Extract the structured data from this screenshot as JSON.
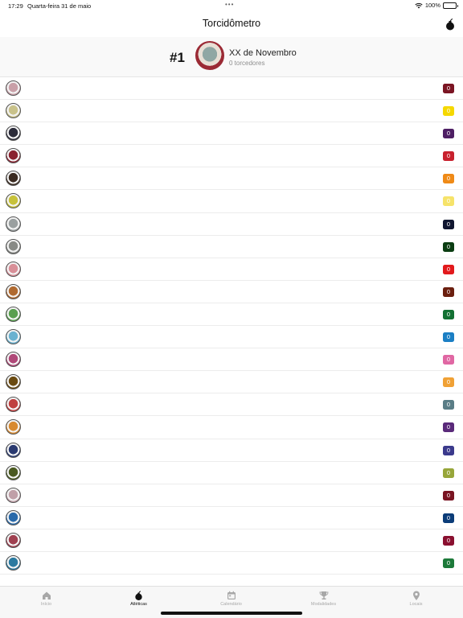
{
  "status_bar": {
    "time": "17:29",
    "date": "Quarta-feira 31 de maio",
    "dots": "•••",
    "battery": "100%"
  },
  "nav": {
    "title": "Torcidômetro",
    "action_icon": "bomb-icon"
  },
  "top_team": {
    "rank": "#1",
    "name": "XX de Novembro",
    "fans": "0 torcedores"
  },
  "colors": {
    "accent": "#111111",
    "inactive": "#a8a8a8"
  },
  "teams": [
    {
      "count": "0",
      "color": "#7b1523",
      "logo": "#c9a0a8",
      "text": "#ffffff"
    },
    {
      "count": "0",
      "color": "#f5d800",
      "logo": "#c9c28a",
      "text": "#ffffff"
    },
    {
      "count": "0",
      "color": "#4e1f64",
      "logo": "#2b2b3a",
      "text": "#ffffff"
    },
    {
      "count": "0",
      "color": "#c8212e",
      "logo": "#8a2230",
      "text": "#ffffff"
    },
    {
      "count": "0",
      "color": "#ef8a17",
      "logo": "#3a2a20",
      "text": "#ffffff"
    },
    {
      "count": "0",
      "color": "#f6e36a",
      "logo": "#c7c23a",
      "text": "#ffffff"
    },
    {
      "count": "0",
      "color": "#101630",
      "logo": "#9aa0a0",
      "text": "#ffffff"
    },
    {
      "count": "0",
      "color": "#0b3d12",
      "logo": "#888a86",
      "text": "#ffffff"
    },
    {
      "count": "0",
      "color": "#e2191c",
      "logo": "#d98f98",
      "text": "#ffffff"
    },
    {
      "count": "0",
      "color": "#6b1f0f",
      "logo": "#b06a30",
      "text": "#ffffff"
    },
    {
      "count": "0",
      "color": "#137133",
      "logo": "#5aa050",
      "text": "#ffffff"
    },
    {
      "count": "0",
      "color": "#1b7fc4",
      "logo": "#6ab2d0",
      "text": "#ffffff"
    },
    {
      "count": "0",
      "color": "#e067a3",
      "logo": "#b04878",
      "text": "#ffffff"
    },
    {
      "count": "0",
      "color": "#f0a135",
      "logo": "#6a4a10",
      "text": "#ffffff"
    },
    {
      "count": "0",
      "color": "#5a7d86",
      "logo": "#c04040",
      "text": "#ffffff"
    },
    {
      "count": "0",
      "color": "#5a2a7a",
      "logo": "#d88a30",
      "text": "#ffffff"
    },
    {
      "count": "0",
      "color": "#3b3a8c",
      "logo": "#2a3a70",
      "text": "#ffffff"
    },
    {
      "count": "0",
      "color": "#97a63a",
      "logo": "#4a5a20",
      "text": "#ffffff"
    },
    {
      "count": "0",
      "color": "#7a1422",
      "logo": "#c0a0a8",
      "text": "#ffffff"
    },
    {
      "count": "0",
      "color": "#0b3c78",
      "logo": "#2a6aaa",
      "text": "#ffffff"
    },
    {
      "count": "0",
      "color": "#8a1030",
      "logo": "#a04050",
      "text": "#ffffff"
    },
    {
      "count": "0",
      "color": "#1d7a3a",
      "logo": "#2a7aa0",
      "text": "#ffffff"
    }
  ],
  "tabs": [
    {
      "label": "Início",
      "icon": "home-icon",
      "active": false
    },
    {
      "label": "Atléticas",
      "icon": "bomb-icon",
      "active": true
    },
    {
      "label": "Calendário",
      "icon": "calendar-icon",
      "active": false
    },
    {
      "label": "Modalidades",
      "icon": "trophy-icon",
      "active": false
    },
    {
      "label": "Locais",
      "icon": "location-pin-icon",
      "active": false
    }
  ]
}
